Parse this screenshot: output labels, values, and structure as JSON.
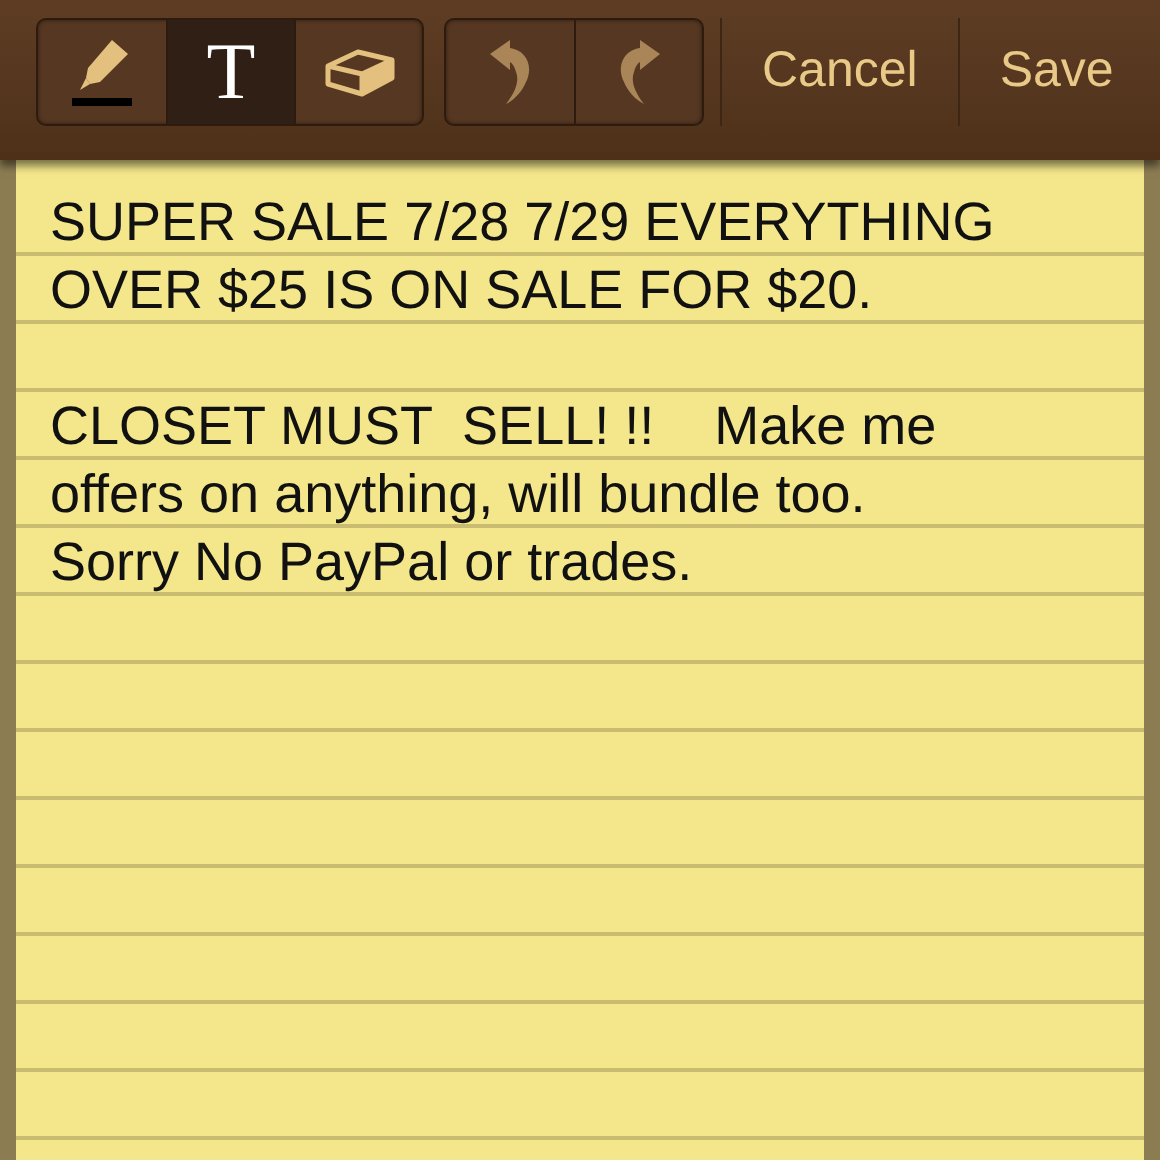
{
  "toolbar": {
    "tools": [
      {
        "kind": "pen",
        "selected": false
      },
      {
        "kind": "text",
        "label": "T",
        "selected": true
      },
      {
        "kind": "eraser",
        "selected": false
      }
    ],
    "history": [
      {
        "kind": "undo"
      },
      {
        "kind": "redo"
      }
    ],
    "actions": [
      "Cancel",
      "Save"
    ]
  },
  "note": {
    "paragraphs": [
      {
        "lines": [
          "SUPER SALE 7/28 7/29 EVERYTHING",
          "OVER $25 IS ON SALE FOR $20."
        ]
      },
      {
        "lines": [
          "CLOSET MUST  SELL! !!    Make me",
          "offers on anything, will bundle too.",
          "Sorry No PayPal or trades."
        ]
      }
    ]
  }
}
